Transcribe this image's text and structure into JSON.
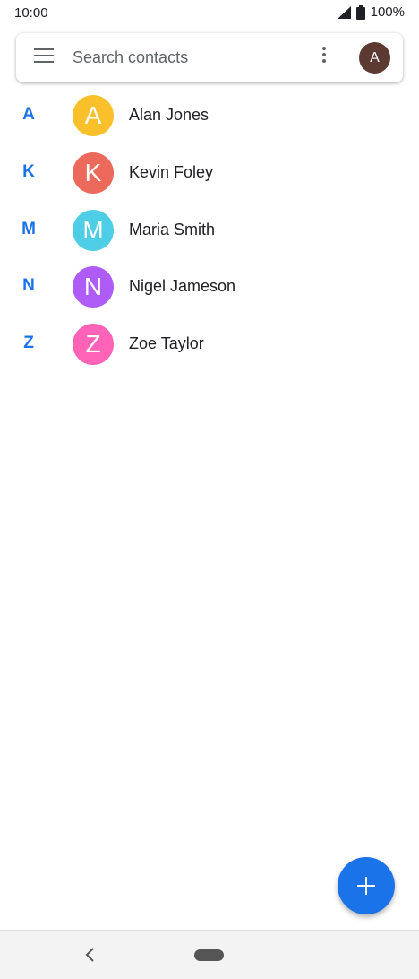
{
  "status_bar": {
    "time": "10:00",
    "battery": "100%"
  },
  "search": {
    "placeholder": "Search contacts",
    "account_initial": "A"
  },
  "contacts": [
    {
      "section": "A",
      "initial": "A",
      "name": "Alan Jones",
      "color": "#f9c02c"
    },
    {
      "section": "K",
      "initial": "K",
      "name": "Kevin Foley",
      "color": "#ec6a5c"
    },
    {
      "section": "M",
      "initial": "M",
      "name": "Maria Smith",
      "color": "#4ecde6"
    },
    {
      "section": "N",
      "initial": "N",
      "name": "Nigel Jameson",
      "color": "#af5cf7"
    },
    {
      "section": "Z",
      "initial": "Z",
      "name": "Zoe Taylor",
      "color": "#ff63b8"
    }
  ],
  "colors": {
    "accent": "#1a73e8",
    "account_avatar": "#5d3a31"
  },
  "icons": {
    "menu": "hamburger-icon",
    "more": "more-vert-icon",
    "fab": "plus-icon",
    "back": "chevron-left-icon"
  }
}
